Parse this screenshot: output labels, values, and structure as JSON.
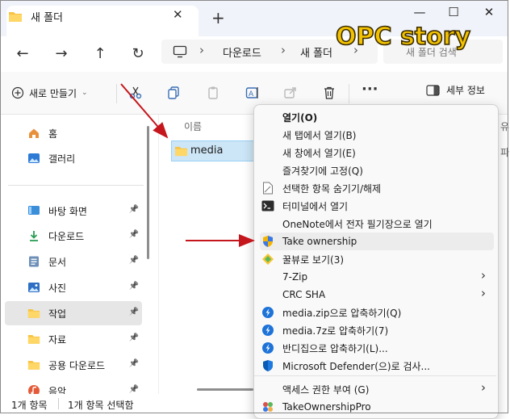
{
  "window": {
    "tab_title": "새 폴더",
    "minimize": "—",
    "maximize": "☐",
    "close": "✕"
  },
  "watermark": "OPC story",
  "address": {
    "crumbs": [
      "다운로드",
      "새 폴더"
    ],
    "search_placeholder": "새 폴더 검색"
  },
  "toolbar": {
    "new_label": "새로 만들기",
    "more": "···",
    "details_label": "세부 정보"
  },
  "sidebar": {
    "items": [
      {
        "label": "홈",
        "icon": "home-icon",
        "pinned": false
      },
      {
        "label": "갤러리",
        "icon": "gallery-icon",
        "pinned": false
      },
      {
        "label": "바탕 화면",
        "icon": "desktop-icon",
        "pinned": true
      },
      {
        "label": "다운로드",
        "icon": "download-icon",
        "pinned": true
      },
      {
        "label": "문서",
        "icon": "document-icon",
        "pinned": true
      },
      {
        "label": "사진",
        "icon": "picture-icon",
        "pinned": true
      },
      {
        "label": "작업",
        "icon": "folder-icon",
        "pinned": true,
        "active": true
      },
      {
        "label": "자료",
        "icon": "folder-icon",
        "pinned": true
      },
      {
        "label": "공용 다운로드",
        "icon": "folder-icon",
        "pinned": true
      },
      {
        "label": "음악",
        "icon": "music-icon",
        "pinned": true
      }
    ]
  },
  "content": {
    "column_name": "이름",
    "column_right_partial": "유",
    "row_right_partial": "파",
    "file_name": "media"
  },
  "status": {
    "count": "1개 항목",
    "selected": "1개 항목 선택함"
  },
  "context_menu": {
    "items": [
      {
        "label": "열기(O)",
        "bold": true,
        "icon": ""
      },
      {
        "label": "새 탭에서 열기(B)",
        "icon": ""
      },
      {
        "label": "새 창에서 열기(E)",
        "icon": ""
      },
      {
        "label": "즐겨찾기에 고정(Q)",
        "icon": ""
      },
      {
        "label": "선택한 항목 숨기기/해제",
        "icon": "page-icon"
      },
      {
        "label": "터미널에서 열기",
        "icon": "terminal-icon"
      },
      {
        "label": "OneNote에서 전자 필기장으로 열기",
        "icon": ""
      },
      {
        "label": "Take ownership",
        "icon": "shield-icon",
        "highlight": true
      },
      {
        "label": "꿀뷰로 보기(3)",
        "icon": "honeyview-icon"
      },
      {
        "label": "7-Zip",
        "icon": "",
        "submenu": true
      },
      {
        "label": "CRC SHA",
        "icon": "",
        "submenu": true
      },
      {
        "label": "media.zip으로 압축하기(Q)",
        "icon": "bandizip-icon"
      },
      {
        "label": "media.7z로 압축하기(7)",
        "icon": "bandizip-icon"
      },
      {
        "label": "반디집으로 압축하기(L)...",
        "icon": "bandizip-icon"
      },
      {
        "label": "Microsoft Defender(으)로 검사...",
        "icon": "defender-icon"
      },
      {
        "label": "액세스 권한 부여 (G)",
        "icon": "",
        "submenu": true
      },
      {
        "label": "TakeOwnershipPro",
        "icon": "takeownership-pro-icon"
      }
    ]
  },
  "colors": {
    "accent": "#0067c0",
    "selection": "#cde6f7",
    "arrow": "#c4161c",
    "watermark_fill": "#f2c200"
  }
}
